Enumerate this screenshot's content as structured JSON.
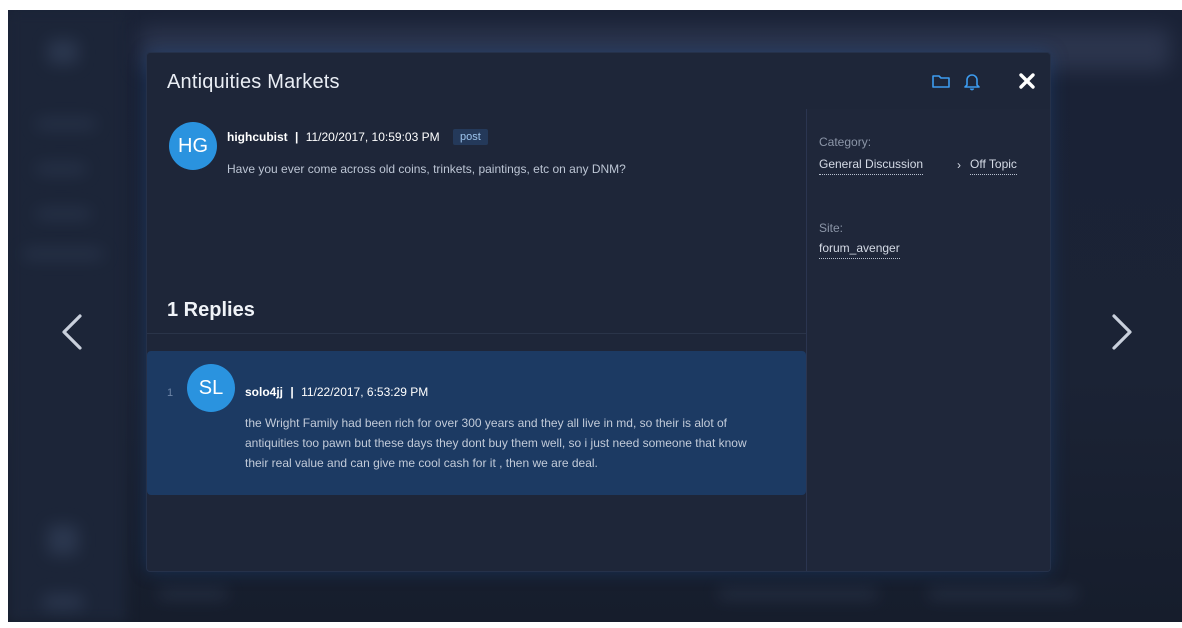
{
  "modal": {
    "title": "Antiquities Markets",
    "header_icons": [
      "folder-icon",
      "bell-icon",
      "close-icon"
    ]
  },
  "post": {
    "avatar_initials": "HG",
    "author": "highcubist",
    "separator": "|",
    "timestamp": "11/20/2017, 10:59:03 PM",
    "badge": "post",
    "body": "Have you ever come across old coins, trinkets, paintings, etc on any DNM?"
  },
  "replies": {
    "title": "1 Replies",
    "items": [
      {
        "index": "1",
        "avatar_initials": "SL",
        "author": "solo4jj",
        "separator": "|",
        "timestamp": "11/22/2017, 6:53:29 PM",
        "body": "the Wright Family had been rich for over 300 years and they all live in md, so their is alot of antiquities too pawn but these days they dont buy them well, so i just need someone that know their real value and can give me cool cash for it , then we are deal."
      }
    ]
  },
  "sidebar": {
    "category_label": "Category:",
    "category_main": "General Discussion",
    "category_sub_chevron": "›",
    "category_sub": "Off Topic",
    "site_label": "Site:",
    "site_value": "forum_avenger"
  },
  "navigation": {
    "prev_icon": "chevron-left-icon",
    "next_icon": "chevron-right-icon"
  },
  "colors": {
    "accent": "#2a93df",
    "modal_bg": "#1e2639",
    "reply_bg": "#1c3a63",
    "icon_blue": "#3d9cf0"
  }
}
